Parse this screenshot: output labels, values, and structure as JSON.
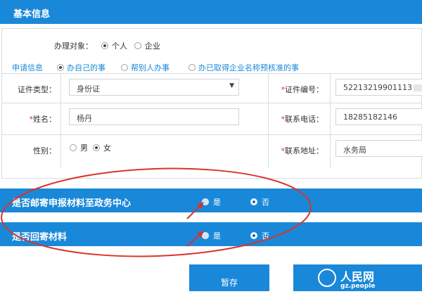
{
  "header": {
    "title": "基本信息"
  },
  "applicant": {
    "label": "办理对象：",
    "options": [
      {
        "label": "个人",
        "selected": true
      },
      {
        "label": "企业",
        "selected": false
      }
    ]
  },
  "application_info": {
    "label": "申请信息",
    "options": [
      {
        "label": "办自己的事",
        "selected": true
      },
      {
        "label": "帮别人办事",
        "selected": false
      },
      {
        "label": "办已取得企业名称预核准的事",
        "selected": false
      }
    ]
  },
  "form": {
    "id_type": {
      "label": "证件类型：",
      "value": "身份证",
      "required": false
    },
    "id_number": {
      "label": "证件编号：",
      "value": "52213219901113",
      "required": true
    },
    "name": {
      "label": "姓名：",
      "value": "杨丹",
      "required": true
    },
    "phone": {
      "label": "联系电话：",
      "value": "18285182146",
      "required": true
    },
    "gender": {
      "label": "性别：",
      "options": [
        {
          "label": "男",
          "selected": false
        },
        {
          "label": "女",
          "selected": true
        }
      ]
    },
    "address": {
      "label": "联系地址：",
      "value": "水务局",
      "required": true
    },
    "required_mark": "*"
  },
  "questions": [
    {
      "text": "是否邮寄申报材料至政务中心",
      "options": [
        {
          "label": "是",
          "selected": false
        },
        {
          "label": "否",
          "selected": true
        }
      ]
    },
    {
      "text": "是否回寄材料",
      "options": [
        {
          "label": "是",
          "selected": false
        },
        {
          "label": "否",
          "selected": true
        }
      ]
    }
  ],
  "buttons": {
    "save": "暂存"
  },
  "watermark": {
    "brand": "人民网",
    "domain": "gz.people"
  },
  "colors": {
    "primary": "#1a88d8",
    "required": "#e0312a",
    "annotation": "#d9342b"
  }
}
